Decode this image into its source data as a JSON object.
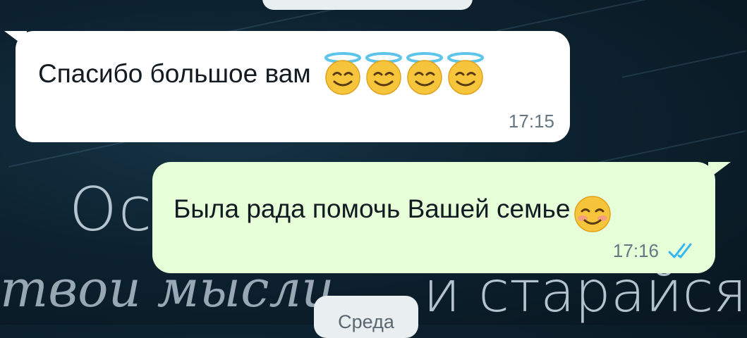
{
  "chat": {
    "incoming": {
      "text": "Спасибо большое вам",
      "emojis": [
        "smiling-face-with-halo",
        "smiling-face-with-halo",
        "smiling-face-with-halo",
        "smiling-face-with-halo"
      ],
      "time": "17:15"
    },
    "outgoing": {
      "text": "Была рада помочь Вашей семье",
      "emojis": [
        "smiling-face-blush"
      ],
      "time": "17:16",
      "status_icon": "double-check-read-icon"
    },
    "date_separator": "Среда"
  },
  "wallpaper": {
    "text_letters": "Ос",
    "text_script": "твои мысли",
    "text_words": "и старайся"
  },
  "colors": {
    "incoming_bubble": "#ffffff",
    "outgoing_bubble": "#e7ffd9",
    "read_ticks": "#34b7f1",
    "background": "#0d2230"
  }
}
